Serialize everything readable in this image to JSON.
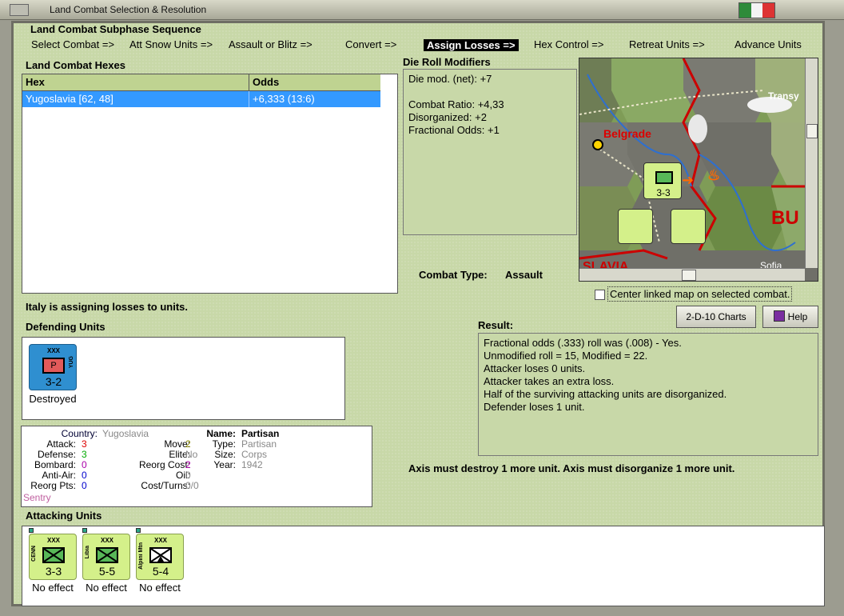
{
  "window": {
    "title": "Land Combat Selection & Resolution"
  },
  "subphase": {
    "heading": "Land Combat Subphase Sequence",
    "steps": [
      "Select Combat =>",
      "Att Snow Units =>",
      "Assault or Blitz =>",
      "Convert =>",
      "Assign Losses =>",
      "Hex Control =>",
      "Retreat Units =>",
      "Advance Units"
    ],
    "active_index": 4
  },
  "hexes": {
    "heading": "Land Combat Hexes",
    "columns": [
      "Hex",
      "Odds"
    ],
    "rows": [
      {
        "hex": "Yugoslavia [62, 48]",
        "odds": "+6,333 (13:6)"
      }
    ]
  },
  "modifiers": {
    "heading": "Die Roll Modifiers",
    "lines": [
      "Die mod. (net): +7",
      "",
      "Combat Ratio: +4,33",
      "Disorganized: +2",
      "Fractional Odds: +1"
    ]
  },
  "combat_type": {
    "label": "Combat Type:",
    "value": "Assault"
  },
  "map": {
    "labels": [
      "Belgrade",
      "Transy",
      "BU",
      "Sofia",
      "SLAVIA"
    ],
    "center_checkbox_label": "Center linked map on selected combat."
  },
  "buttons": {
    "charts": "2-D-10 Charts",
    "help": "Help"
  },
  "assign_message": "Italy is assigning losses to units.",
  "defending": {
    "heading": "Defending Units",
    "units": [
      {
        "size": "XXX",
        "symbol": "P",
        "nation": "YUG",
        "values": "3-2",
        "status": "Destroyed"
      }
    ]
  },
  "details": {
    "country_label": "Country:",
    "country": "Yugoslavia",
    "attack_label": "Attack:",
    "attack": "3",
    "defense_label": "Defense:",
    "defense": "3",
    "bombard_label": "Bombard:",
    "bombard": "0",
    "antiair_label": "Anti-Air:",
    "antiair": "0",
    "reorgpts_label": "Reorg Pts:",
    "reorgpts": "0",
    "mission": "Sentry",
    "move_label": "Move:",
    "move": "2",
    "elite_label": "Elite:",
    "elite": "No",
    "reorgcost_label": "Reorg Cost:",
    "reorgcost": "2",
    "oil_label": "Oil:",
    "oil": "0",
    "costturns_label": "Cost/Turns:",
    "costturns": "0/0",
    "name_label": "Name:",
    "name": "Partisan",
    "type_label": "Type:",
    "type": "Partisan",
    "size_label": "Size:",
    "size": "Corps",
    "year_label": "Year:",
    "year": "1942"
  },
  "result": {
    "heading": "Result:",
    "lines": [
      "Fractional odds (.333) roll was (.008)  - Yes.",
      "Unmodified roll = 15, Modified = 22.",
      "Attacker loses 0 units.",
      "Attacker takes an extra loss.",
      "Half of the surviving attacking units are disorganized.",
      "Defender loses 1 unit."
    ]
  },
  "requirement": "Axis must destroy 1 more unit. Axis must disorganize 1 more unit.",
  "attacking": {
    "heading": "Attacking Units",
    "units": [
      {
        "size": "XXX",
        "name": "CENN",
        "values": "3-3",
        "status": "No effect"
      },
      {
        "size": "XXX",
        "name": "Libia",
        "values": "5-5",
        "status": "No effect"
      },
      {
        "size": "XXX",
        "name": "Alpini Mtn",
        "values": "5-4",
        "status": "No effect"
      }
    ]
  },
  "colors": {
    "panel": "#c8d8a8",
    "selection": "#3399ff",
    "yug_unit": "#2f8fd0",
    "italy_unit": "#d4f08a"
  }
}
